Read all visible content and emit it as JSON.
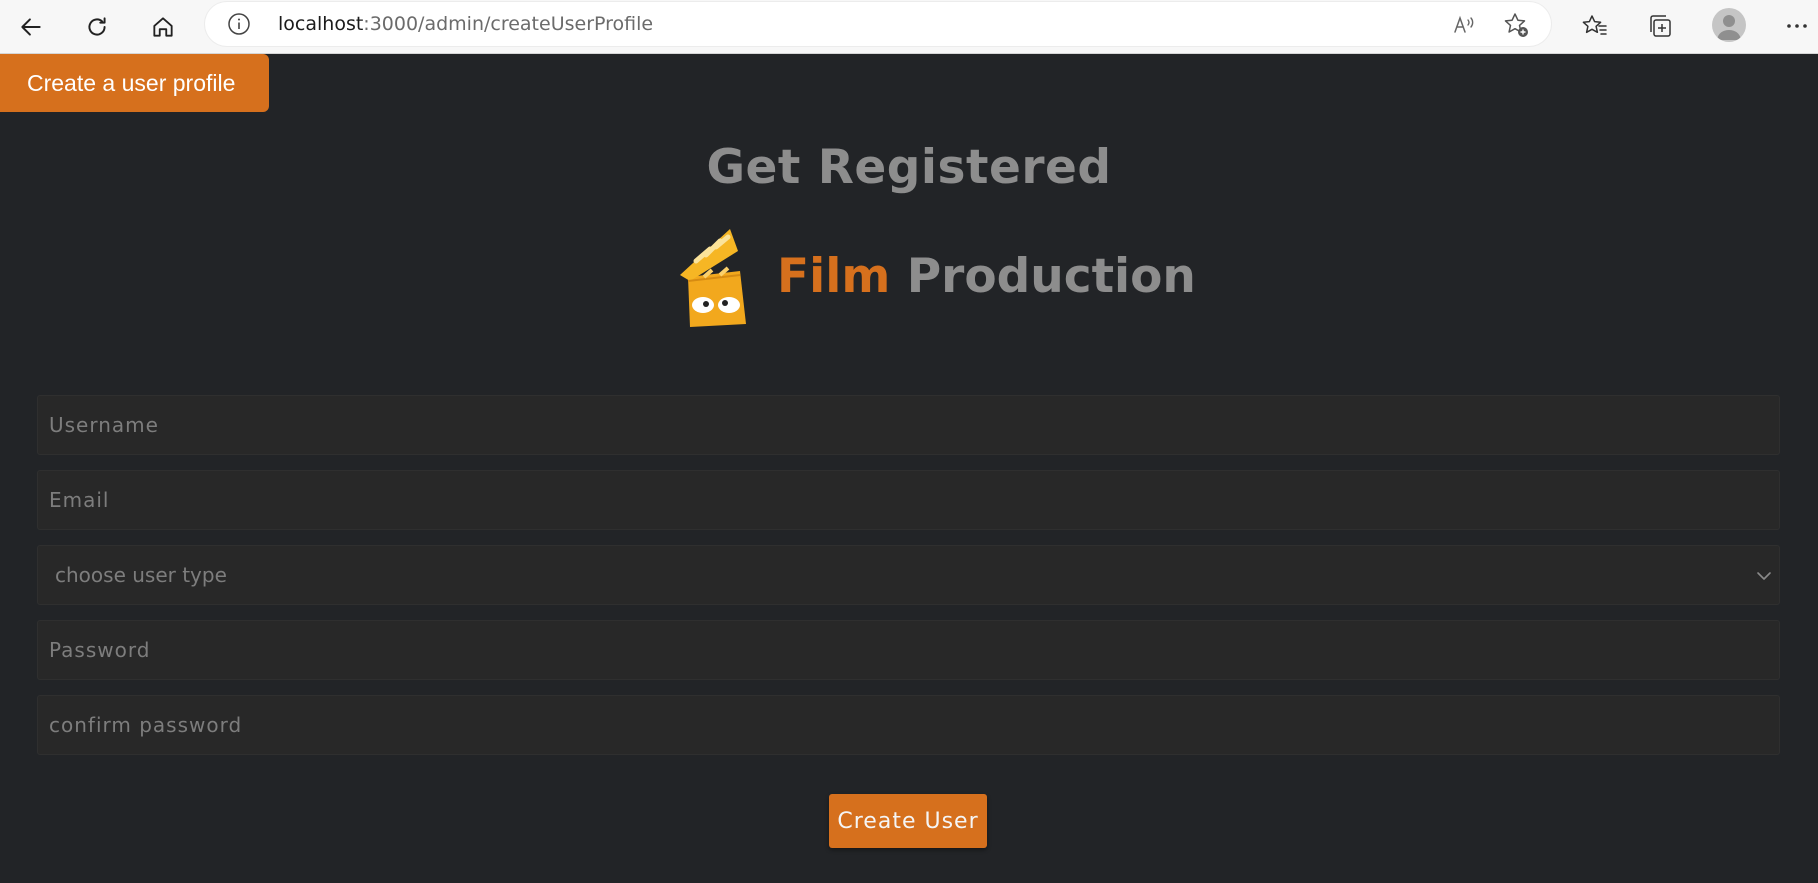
{
  "browser": {
    "url_host": "localhost",
    "url_path": ":3000/admin/createUserProfile"
  },
  "page": {
    "tab_label": "Create a user profile",
    "heading": "Get Registered",
    "brand_word1": "Film",
    "brand_word2": "Production"
  },
  "form": {
    "username_placeholder": "Username",
    "email_placeholder": "Email",
    "user_type_selected": "choose user type",
    "password_placeholder": "Password",
    "confirm_password_placeholder": "confirm password",
    "submit_label": "Create User"
  },
  "colors": {
    "background": "#222427",
    "accent": "#d6701d",
    "muted_text": "#8d8d8d"
  }
}
